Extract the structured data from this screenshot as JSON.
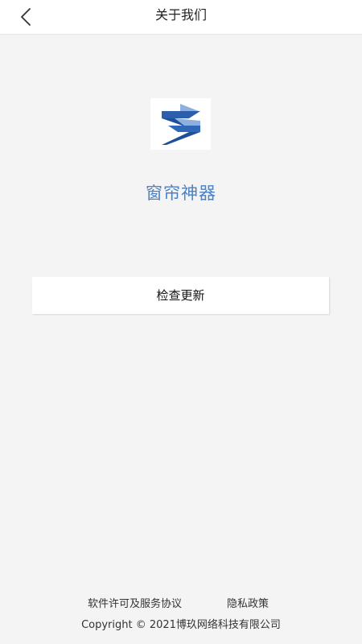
{
  "header": {
    "title": "关于我们",
    "back_icon": "chevron-left-icon"
  },
  "app": {
    "logo_icon": "app-logo-s",
    "name": "窗帘神器",
    "name_color": "#4a80c6"
  },
  "actions": {
    "check_update_label": "检查更新"
  },
  "footer": {
    "license_link": "软件许可及服务协议",
    "privacy_link": "隐私政策",
    "copyright": "Copyright © 2021博玖网络科技有限公司"
  }
}
